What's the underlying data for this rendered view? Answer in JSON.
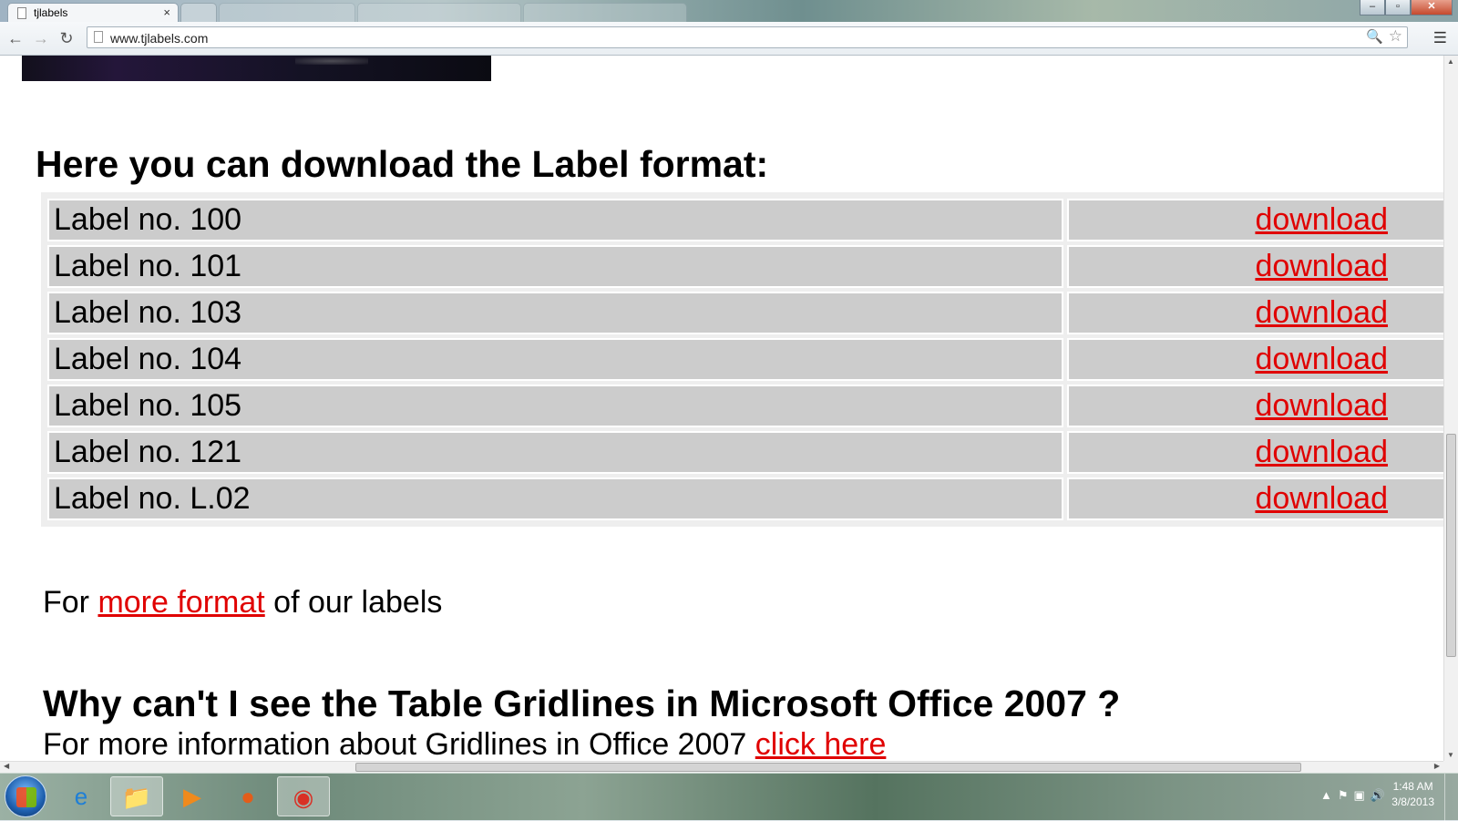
{
  "browser": {
    "tab_title": "tjlabels",
    "tab_close": "×",
    "url": "www.tjlabels.com",
    "window_controls": {
      "minimize": "–",
      "maximize": "▫",
      "close": "✕"
    }
  },
  "page": {
    "heading1": "Here you can download the Label format:",
    "labels": [
      {
        "name": "Label no. 100",
        "link": "download"
      },
      {
        "name": "Label no. 101",
        "link": "download"
      },
      {
        "name": "Label no. 103",
        "link": "download"
      },
      {
        "name": "Label no. 104",
        "link": "download"
      },
      {
        "name": "Label no. 105",
        "link": "download"
      },
      {
        "name": "Label no. 121",
        "link": "download"
      },
      {
        "name": "Label no. L.02",
        "link": "download"
      }
    ],
    "more_line": {
      "prefix": "For ",
      "link": "more format",
      "suffix": " of our labels"
    },
    "heading2": "Why can't I see the Table Gridlines in Microsoft Office 2007 ?",
    "info_line": {
      "prefix": "For more information about Gridlines in Office 2007  ",
      "link": "click here"
    },
    "link_color": "#e00000"
  },
  "taskbar": {
    "icons": [
      "start-button",
      "internet-explorer-icon",
      "file-explorer-icon",
      "media-player-icon",
      "firefox-icon",
      "chrome-icon"
    ],
    "clock_time": "1:48 AM",
    "clock_date": "3/8/2013"
  }
}
